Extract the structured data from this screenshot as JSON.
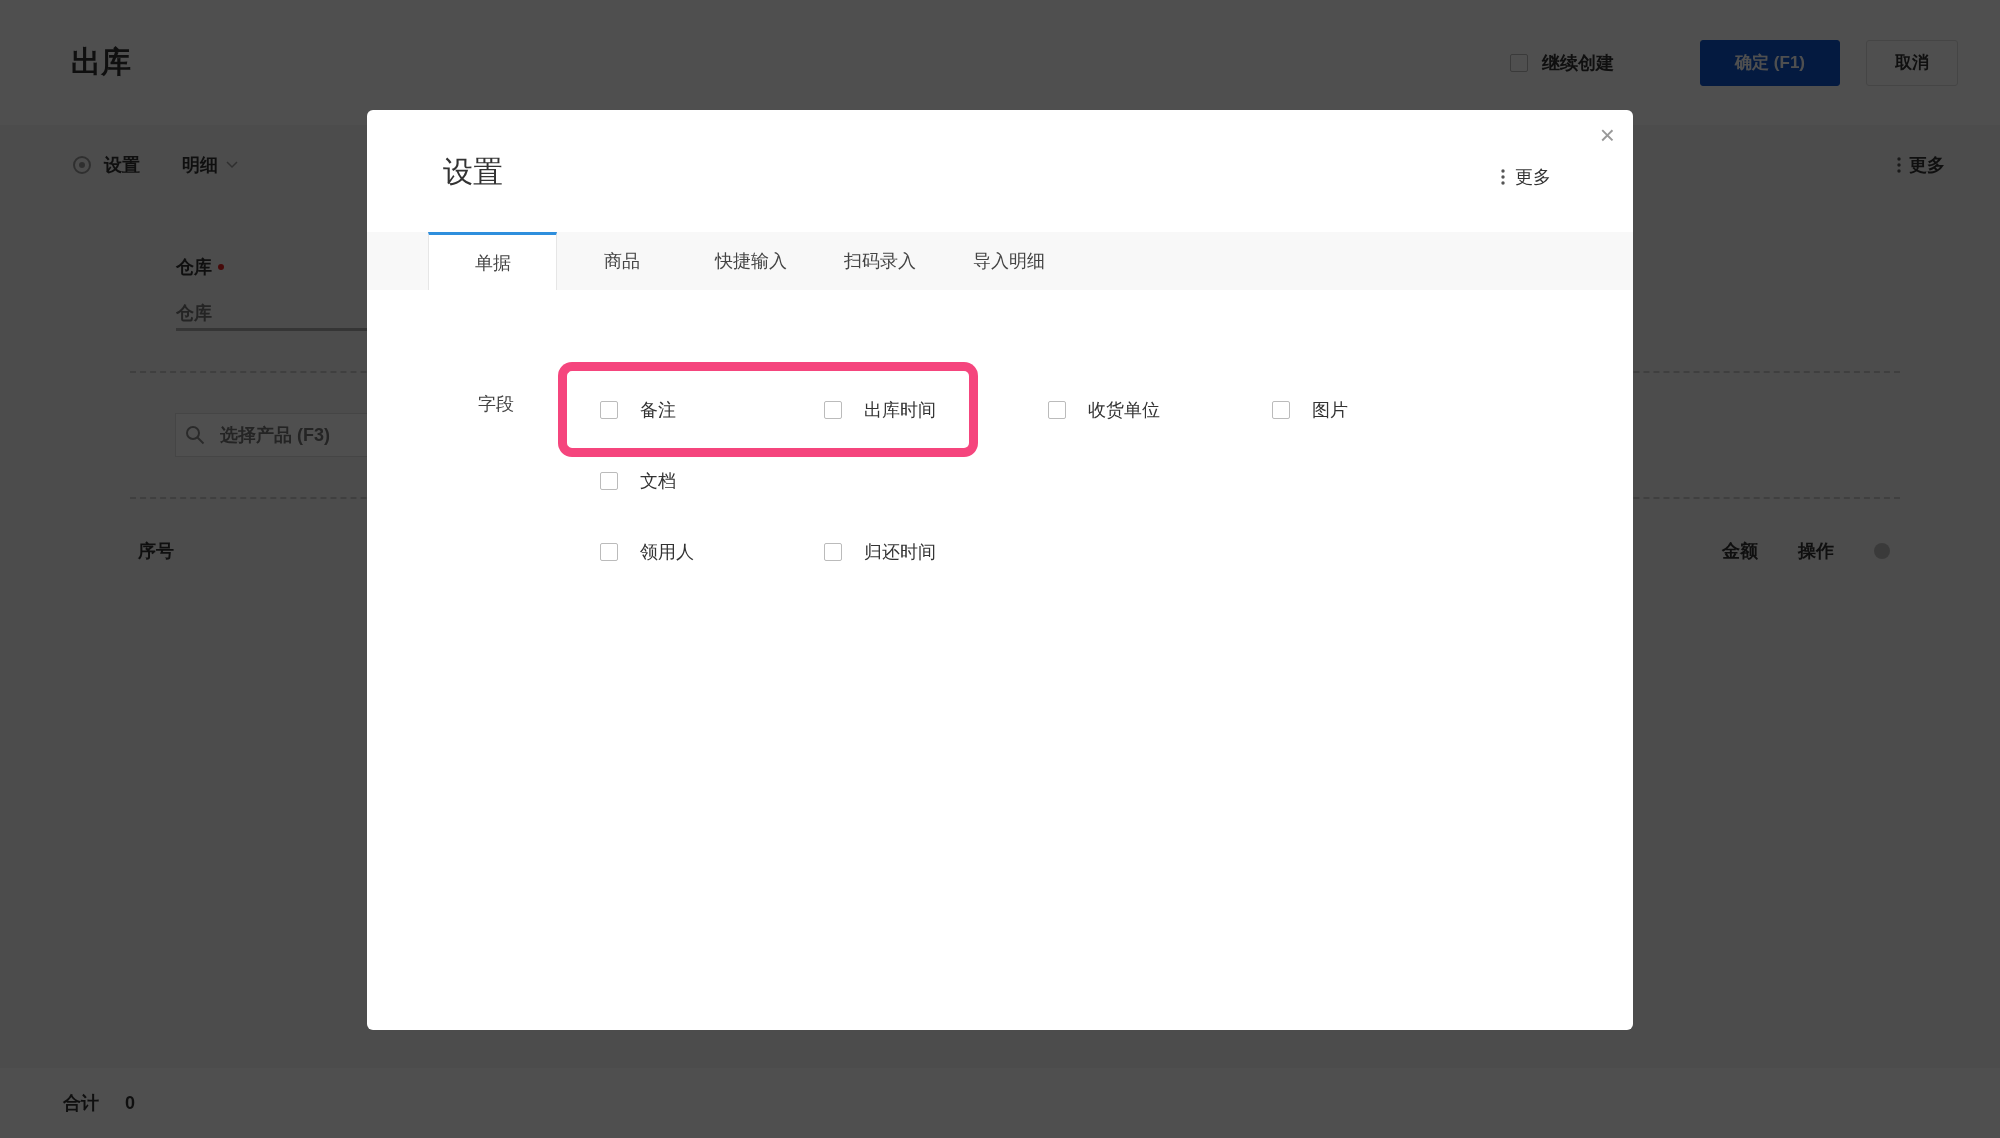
{
  "page": {
    "title": "出库",
    "continue_create": {
      "label": "继续创建",
      "checked": false
    },
    "buttons": [
      {
        "label": "确定 (F1)",
        "kind": "primary"
      },
      {
        "label": "取消",
        "kind": "default"
      }
    ],
    "toolbar": {
      "settings": "设置",
      "detail": "明细",
      "more": "更多"
    },
    "warehouse": {
      "label": "仓库",
      "required": true,
      "placeholder": "仓库"
    },
    "product_search": {
      "placeholder": "选择产品 (F3)"
    },
    "table": {
      "columns": [
        {
          "label": "序号"
        },
        {
          "label": "金额"
        },
        {
          "label": "操作"
        }
      ]
    },
    "footer": {
      "label": "合计",
      "value": "0"
    }
  },
  "dialog": {
    "close": "×",
    "title": "设置",
    "more": "更多",
    "tabs": [
      {
        "label": "单据",
        "selected": true
      },
      {
        "label": "商品",
        "selected": false
      },
      {
        "label": "快捷输入",
        "selected": false
      },
      {
        "label": "扫码录入",
        "selected": false
      },
      {
        "label": "导入明细",
        "selected": false
      }
    ],
    "section_label": "字段",
    "field_rows": [
      [
        {
          "label": "备注",
          "checked": false,
          "highlighted": true
        },
        {
          "label": "出库时间",
          "checked": false,
          "highlighted": true
        },
        {
          "label": "收货单位",
          "checked": false,
          "highlighted": false
        },
        {
          "label": "图片",
          "checked": false,
          "highlighted": false
        }
      ],
      [
        {
          "label": "文档",
          "checked": false,
          "highlighted": false
        }
      ],
      [
        {
          "label": "领用人",
          "checked": false,
          "highlighted": false
        },
        {
          "label": "归还时间",
          "checked": false,
          "highlighted": false
        }
      ]
    ]
  }
}
